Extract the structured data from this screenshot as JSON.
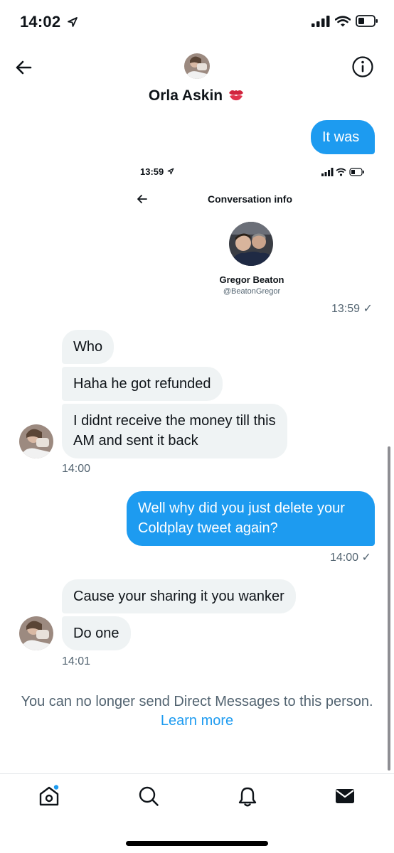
{
  "status_bar": {
    "time": "14:02"
  },
  "header": {
    "contact_name": "Orla Askin"
  },
  "messages": {
    "sent_1": "It was",
    "screenshot": {
      "time": "13:59",
      "title": "Conversation info",
      "name": "Gregor Beaton",
      "handle": "@BeatonGregor"
    },
    "time_1": "13:59 ✓",
    "recv_1": "Who",
    "recv_2": "Haha he got refunded",
    "recv_3_line1": "I didnt receive the money till this",
    "recv_3_line2": "AM and sent it back",
    "time_2": "14:00",
    "sent_2_line1": "Well why did you just delete your",
    "sent_2_line2": "Coldplay tweet again?",
    "time_3": "14:00 ✓",
    "recv_4": "Cause your sharing it you wanker",
    "recv_5": "Do one",
    "time_4": "14:01"
  },
  "notice": {
    "text": "You can no longer send Direct Messages to this person.",
    "link": "Learn more"
  },
  "tabs": [
    "home-icon",
    "search-icon",
    "bell-icon",
    "mail-icon"
  ],
  "colors": {
    "accent": "#1d9bf0",
    "received_bubble": "#eff3f4",
    "muted": "#536471"
  }
}
